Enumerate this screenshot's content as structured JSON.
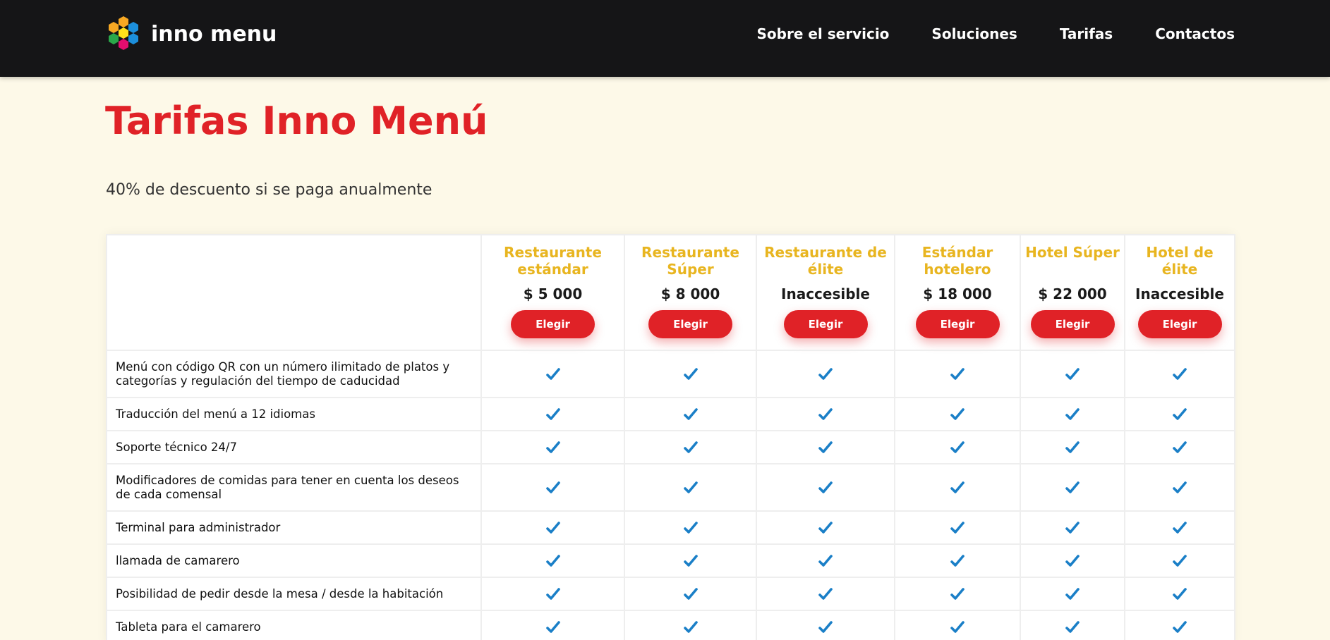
{
  "header": {
    "logo_text": "inno menu",
    "logo_colors": [
      "#1c8fdc",
      "#f7a823",
      "#2aa84a",
      "#ffe31a",
      "#e30d6f"
    ],
    "background": "#151517",
    "nav": [
      {
        "label": "Sobre el servicio"
      },
      {
        "label": "Soluciones"
      },
      {
        "label": "Tarifas"
      },
      {
        "label": "Contactos"
      }
    ]
  },
  "main": {
    "title": "Tarifas Inno Menú",
    "discount_text": "40% de descuento si se paga anualmente",
    "accent": "#e02227",
    "plan_name_color": "#e8b520",
    "check_color": "#1a7fc7"
  },
  "plans": [
    {
      "name": "Restaurante estándar",
      "price": "$ 5 000",
      "button": "Elegir"
    },
    {
      "name": "Restaurante Súper",
      "price": "$ 8 000",
      "button": "Elegir"
    },
    {
      "name": "Restaurante de élite",
      "price": "Inaccesible",
      "button": "Elegir"
    },
    {
      "name": "Estándar hotelero",
      "price": "$ 18 000",
      "button": "Elegir"
    },
    {
      "name": "Hotel Súper",
      "price": "$ 22 000",
      "button": "Elegir"
    },
    {
      "name": "Hotel de élite",
      "price": "Inaccesible",
      "button": "Elegir"
    }
  ],
  "features": [
    {
      "label": "Menú con código QR con un número ilimitado de platos y categorías y regulación del tiempo de caducidad",
      "included": [
        true,
        true,
        true,
        true,
        true,
        true
      ]
    },
    {
      "label": "Traducción del menú a 12 idiomas",
      "included": [
        true,
        true,
        true,
        true,
        true,
        true
      ]
    },
    {
      "label": "Soporte técnico 24/7",
      "included": [
        true,
        true,
        true,
        true,
        true,
        true
      ]
    },
    {
      "label": "Modificadores de comidas para tener en cuenta los deseos de cada comensal",
      "included": [
        true,
        true,
        true,
        true,
        true,
        true
      ]
    },
    {
      "label": "Terminal para administrador",
      "included": [
        true,
        true,
        true,
        true,
        true,
        true
      ]
    },
    {
      "label": "llamada de camarero",
      "included": [
        true,
        true,
        true,
        true,
        true,
        true
      ]
    },
    {
      "label": "Posibilidad de pedir desde la mesa / desde la habitación",
      "included": [
        true,
        true,
        true,
        true,
        true,
        true
      ]
    },
    {
      "label": "Tableta para el camarero",
      "included": [
        true,
        true,
        true,
        true,
        true,
        true
      ]
    }
  ]
}
